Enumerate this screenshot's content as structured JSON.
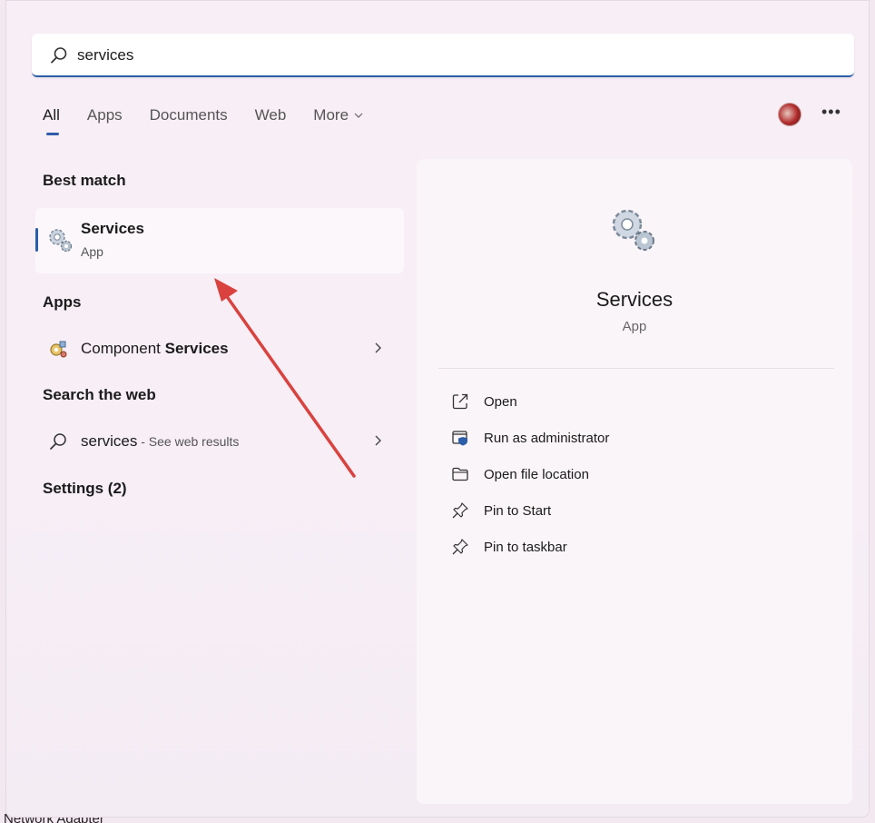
{
  "search": {
    "value": "services"
  },
  "tabs": [
    {
      "label": "All",
      "active": true
    },
    {
      "label": "Apps"
    },
    {
      "label": "Documents"
    },
    {
      "label": "Web"
    },
    {
      "label": "More"
    }
  ],
  "left": {
    "best_match_heading": "Best match",
    "best_match": {
      "title": "Services",
      "type": "App",
      "icon": "services-gear-icon"
    },
    "apps_heading": "Apps",
    "apps_item": {
      "label_prefix": "Component ",
      "label_bold": "Services",
      "icon": "component-services-icon"
    },
    "web_heading": "Search the web",
    "web_item": {
      "query": "services",
      "hint": " - See web results",
      "icon": "search-icon"
    },
    "settings_heading": "Settings (2)"
  },
  "detail": {
    "title": "Services",
    "type": "App",
    "actions": [
      {
        "label": "Open",
        "icon": "open-external-icon"
      },
      {
        "label": "Run as administrator",
        "icon": "shield-admin-icon"
      },
      {
        "label": "Open file location",
        "icon": "folder-icon"
      },
      {
        "label": "Pin to Start",
        "icon": "pin-icon"
      },
      {
        "label": "Pin to taskbar",
        "icon": "pin-icon"
      }
    ]
  },
  "background": {
    "partial_text": "Network Adapter"
  },
  "colors": {
    "accent": "#2c5da8",
    "annotation_arrow": "#d9423e"
  }
}
